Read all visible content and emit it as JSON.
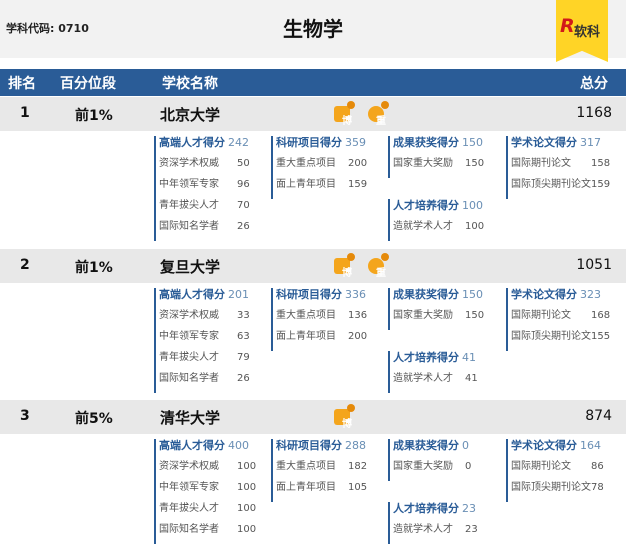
{
  "header": {
    "code_label": "学科代码:",
    "code_value": "0710",
    "title": "生物学",
    "brand_icon": "R",
    "brand": "软科"
  },
  "columns": {
    "rank": "排名",
    "percentile": "百分位段",
    "school": "学校名称",
    "score": "总分"
  },
  "schools": [
    {
      "rank": "1",
      "percentile": "前1%",
      "name": "北京大学",
      "total": "1168",
      "badges": [
        "博",
        "重"
      ],
      "talent": {
        "label": "高端人才得分",
        "score": "242",
        "items": [
          [
            "资深学术权威",
            "50"
          ],
          [
            "中年领军专家",
            "96"
          ],
          [
            "青年拔尖人才",
            "70"
          ],
          [
            "国际知名学者",
            "26"
          ]
        ]
      },
      "research": {
        "label": "科研项目得分",
        "score": "359",
        "items": [
          [
            "重大重点项目",
            "200"
          ],
          [
            "面上青年项目",
            "159"
          ]
        ]
      },
      "award": {
        "label": "成果获奖得分",
        "score": "150",
        "items": [
          [
            "国家重大奖励",
            "150"
          ]
        ]
      },
      "training": {
        "label": "人才培养得分",
        "score": "100",
        "items": [
          [
            "造就学术人才",
            "100"
          ]
        ]
      },
      "papers": {
        "label": "学术论文得分",
        "score": "317",
        "items": [
          [
            "国际期刊论文",
            "158"
          ],
          [
            "国际顶尖期刊论文",
            "159"
          ]
        ]
      }
    },
    {
      "rank": "2",
      "percentile": "前1%",
      "name": "复旦大学",
      "total": "1051",
      "badges": [
        "博",
        "重"
      ],
      "talent": {
        "label": "高端人才得分",
        "score": "201",
        "items": [
          [
            "资深学术权威",
            "33"
          ],
          [
            "中年领军专家",
            "63"
          ],
          [
            "青年拔尖人才",
            "79"
          ],
          [
            "国际知名学者",
            "26"
          ]
        ]
      },
      "research": {
        "label": "科研项目得分",
        "score": "336",
        "items": [
          [
            "重大重点项目",
            "136"
          ],
          [
            "面上青年项目",
            "200"
          ]
        ]
      },
      "award": {
        "label": "成果获奖得分",
        "score": "150",
        "items": [
          [
            "国家重大奖励",
            "150"
          ]
        ]
      },
      "training": {
        "label": "人才培养得分",
        "score": "41",
        "items": [
          [
            "造就学术人才",
            "41"
          ]
        ]
      },
      "papers": {
        "label": "学术论文得分",
        "score": "323",
        "items": [
          [
            "国际期刊论文",
            "168"
          ],
          [
            "国际顶尖期刊论文",
            "155"
          ]
        ]
      }
    },
    {
      "rank": "3",
      "percentile": "前5%",
      "name": "清华大学",
      "total": "874",
      "badges": [
        "博"
      ],
      "talent": {
        "label": "高端人才得分",
        "score": "400",
        "items": [
          [
            "资深学术权威",
            "100"
          ],
          [
            "中年领军专家",
            "100"
          ],
          [
            "青年拔尖人才",
            "100"
          ],
          [
            "国际知名学者",
            "100"
          ]
        ]
      },
      "research": {
        "label": "科研项目得分",
        "score": "288",
        "items": [
          [
            "重大重点项目",
            "182"
          ],
          [
            "面上青年项目",
            "105"
          ]
        ]
      },
      "award": {
        "label": "成果获奖得分",
        "score": "0",
        "items": [
          [
            "国家重大奖励",
            "0"
          ]
        ]
      },
      "training": {
        "label": "人才培养得分",
        "score": "23",
        "items": [
          [
            "造就学术人才",
            "23"
          ]
        ]
      },
      "papers": {
        "label": "学术论文得分",
        "score": "164",
        "items": [
          [
            "国际期刊论文",
            "86"
          ],
          [
            "国际顶尖期刊论文",
            "78"
          ]
        ]
      }
    }
  ]
}
